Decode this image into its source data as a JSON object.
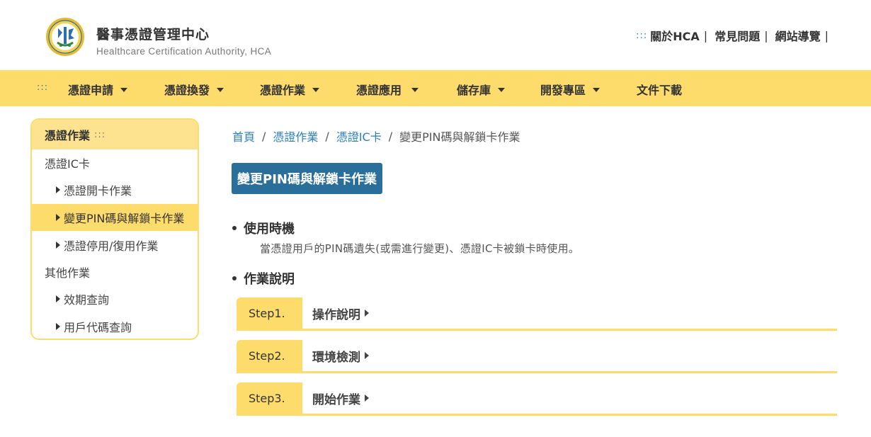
{
  "header": {
    "title": "醫事憑證管理中心",
    "subtitle": "Healthcare Certification Authority, HCA",
    "dots": ":::",
    "links": [
      {
        "label": "關於HCA"
      },
      {
        "label": "常見問題"
      },
      {
        "label": "網站導覽"
      }
    ],
    "separator": "|"
  },
  "nav": {
    "dots": ":::",
    "items": [
      {
        "label": "憑證申請",
        "has_dropdown": true
      },
      {
        "label": "憑證換發",
        "has_dropdown": true
      },
      {
        "label": "憑證作業",
        "has_dropdown": true
      },
      {
        "label": "憑證應用",
        "has_dropdown": true
      },
      {
        "label": "儲存庫",
        "has_dropdown": true
      },
      {
        "label": "開發專區",
        "has_dropdown": true
      },
      {
        "label": "文件下載",
        "has_dropdown": false
      }
    ]
  },
  "sidebar": {
    "title": "憑證作業",
    "title_dots": ":::",
    "groups": [
      {
        "label": "憑證IC卡",
        "items": [
          {
            "label": "憑證開卡作業",
            "active": false
          },
          {
            "label": "變更PIN碼與解鎖卡作業",
            "active": true
          },
          {
            "label": "憑證停用/復用作業",
            "active": false
          }
        ]
      },
      {
        "label": "其他作業",
        "items": [
          {
            "label": "效期查詢",
            "active": false
          },
          {
            "label": "用戶代碼查詢",
            "active": false
          }
        ]
      }
    ]
  },
  "breadcrumb": {
    "items": [
      "首頁",
      "憑證作業",
      "憑證IC卡"
    ],
    "current": "變更PIN碼與解鎖卡作業",
    "separator": "/"
  },
  "page": {
    "title": "變更PIN碼與解鎖卡作業",
    "section1_title": "使用時機",
    "section1_desc": "當憑證用戶的PIN碼遺失(或需進行變更)、憑證IC卡被鎖卡時使用。",
    "section2_title": "作業說明",
    "steps": [
      {
        "label": "Step1.",
        "text": "操作說明"
      },
      {
        "label": "Step2.",
        "text": "環境檢測"
      },
      {
        "label": "Step3.",
        "text": "開始作業"
      }
    ]
  },
  "colors": {
    "accent_yellow": "#fddc6c",
    "title_blue": "#2a6f9b",
    "link_blue": "#2a7fbf"
  }
}
